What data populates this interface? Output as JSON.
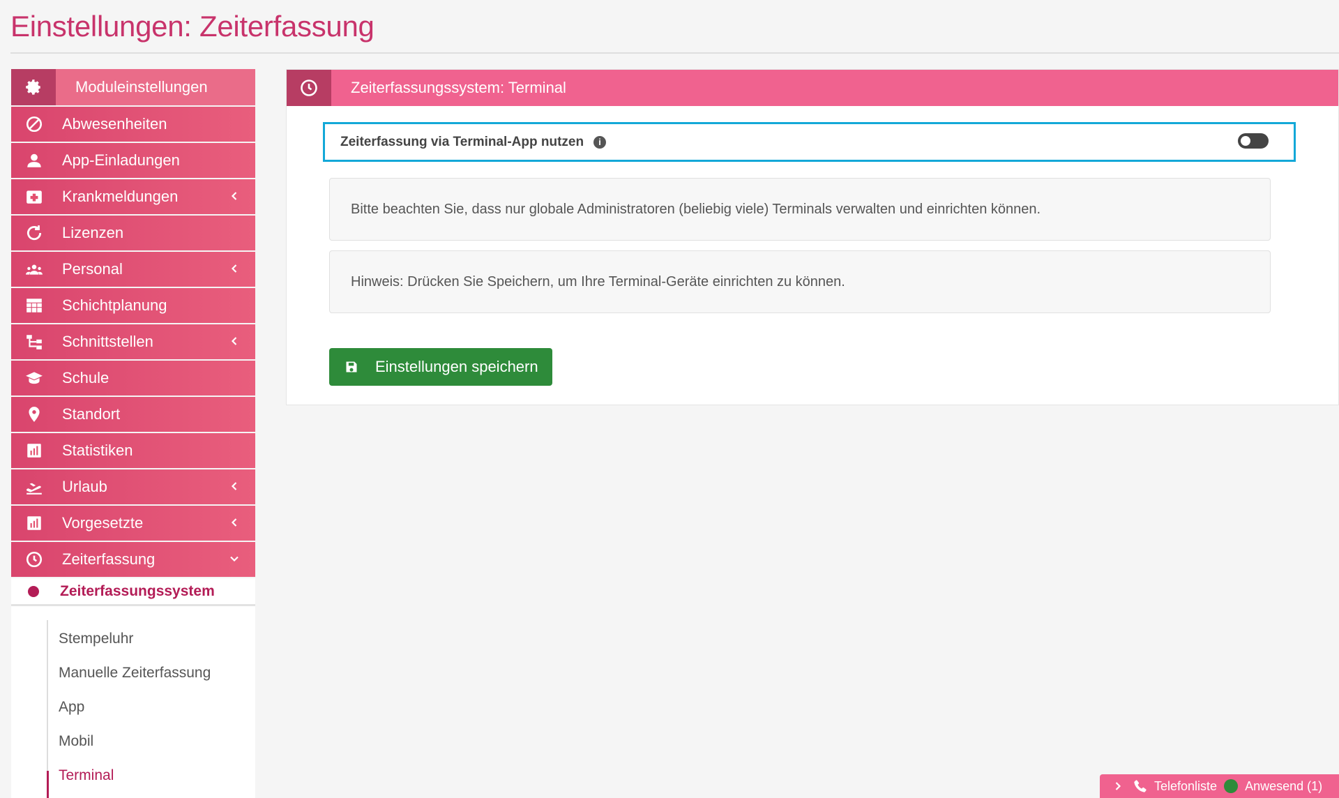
{
  "page": {
    "title": "Einstellungen: Zeiterfassung"
  },
  "sidebar": {
    "header": "Moduleinstellungen",
    "items": [
      {
        "label": "Abwesenheiten",
        "icon": "ban-icon",
        "has_submenu": false
      },
      {
        "label": "App-Einladungen",
        "icon": "user-icon",
        "has_submenu": false
      },
      {
        "label": "Krankmeldungen",
        "icon": "medkit-icon",
        "has_submenu": true
      },
      {
        "label": "Lizenzen",
        "icon": "refresh-icon",
        "has_submenu": false
      },
      {
        "label": "Personal",
        "icon": "users-icon",
        "has_submenu": true
      },
      {
        "label": "Schichtplanung",
        "icon": "table-icon",
        "has_submenu": false
      },
      {
        "label": "Schnittstellen",
        "icon": "sitemap-icon",
        "has_submenu": true
      },
      {
        "label": "Schule",
        "icon": "graduation-cap-icon",
        "has_submenu": false
      },
      {
        "label": "Standort",
        "icon": "map-marker-icon",
        "has_submenu": false
      },
      {
        "label": "Statistiken",
        "icon": "bar-chart-icon",
        "has_submenu": false
      },
      {
        "label": "Urlaub",
        "icon": "plane-icon",
        "has_submenu": true
      },
      {
        "label": "Vorgesetzte",
        "icon": "bar-chart-icon",
        "has_submenu": true
      },
      {
        "label": "Zeiterfassung",
        "icon": "clock-icon",
        "has_submenu": true,
        "expanded": true
      }
    ],
    "active_sub": "Zeiterfassungssystem",
    "sub_links": [
      "Stempeluhr",
      "Manuelle Zeiterfassung",
      "App",
      "Mobil",
      "Terminal"
    ],
    "selected_sub_link": "Terminal"
  },
  "panel": {
    "title": "Zeiterfassungssystem: Terminal",
    "toggle_label": "Zeiterfassung via Terminal-App nutzen",
    "toggle_on": false,
    "note1": "Bitte beachten Sie, dass nur globale Administratoren (beliebig viele) Terminals verwalten und einrichten können.",
    "note2": "Hinweis: Drücken Sie Speichern, um Ihre Terminal-Geräte einrichten zu können.",
    "save_label": "Einstellungen speichern"
  },
  "bottom_bar": {
    "phone_label": "Telefonliste",
    "present_label": "Anwesend (1)"
  },
  "colors": {
    "accent": "#c8336b",
    "header_pink": "#f0628f",
    "save_green": "#2e8b3a",
    "focus_blue": "#13a8d8"
  }
}
